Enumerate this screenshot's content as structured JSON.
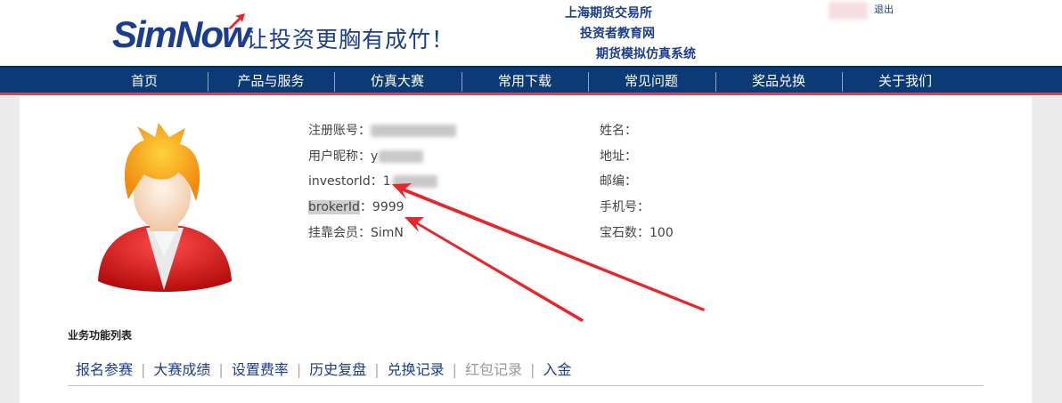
{
  "header": {
    "logo_text": "SimNow",
    "slogan": "让投资更胸有成竹！",
    "links": [
      "上海期货交易所",
      "投资者教育网",
      "期货模拟仿真系统"
    ],
    "logout": "退出"
  },
  "nav": {
    "items": [
      "首页",
      "产品与服务",
      "仿真大赛",
      "常用下载",
      "常见问题",
      "奖品兑换",
      "关于我们"
    ]
  },
  "profile": {
    "left": [
      {
        "label": "注册账号：",
        "value": ""
      },
      {
        "label": "用户昵称：",
        "value": "y"
      },
      {
        "label": "investorId：",
        "value": "1"
      },
      {
        "label": "brokerId",
        "sep": "：",
        "value": "9999"
      },
      {
        "label": "挂靠会员：",
        "value": "SimN"
      }
    ],
    "right": [
      {
        "label": "姓名：",
        "value": ""
      },
      {
        "label": "地址：",
        "value": ""
      },
      {
        "label": "邮编：",
        "value": ""
      },
      {
        "label": "手机号：",
        "value": ""
      },
      {
        "label": "宝石数：",
        "value": "100"
      }
    ]
  },
  "functions": {
    "title": "业务功能列表",
    "items": [
      {
        "label": "报名参赛",
        "enabled": true
      },
      {
        "label": "大赛成绩",
        "enabled": true
      },
      {
        "label": "设置费率",
        "enabled": true
      },
      {
        "label": "历史复盘",
        "enabled": true
      },
      {
        "label": "兑换记录",
        "enabled": true
      },
      {
        "label": "红包记录",
        "enabled": false
      },
      {
        "label": "入金",
        "enabled": true
      }
    ],
    "separator": "|"
  },
  "colors": {
    "brand_blue": "#1a3d8f",
    "nav_bg": "#0b3a74",
    "nav_underline": "#c9485a",
    "annotation_red": "#e8262a"
  }
}
